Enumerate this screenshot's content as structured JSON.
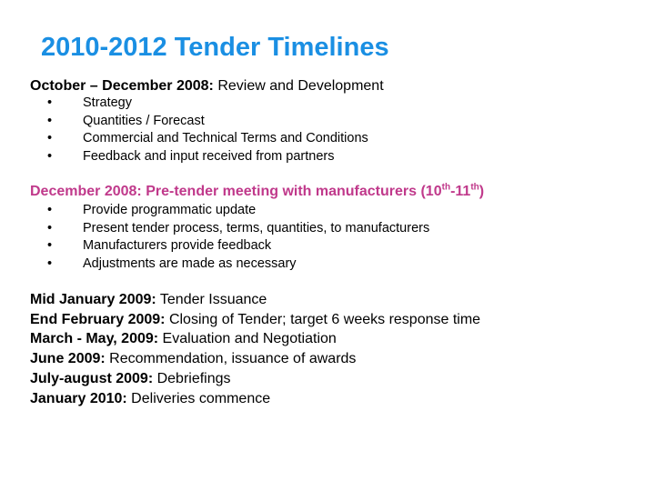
{
  "title": "2010-2012 Tender Timelines",
  "colors": {
    "title": "#1a8fe3",
    "highlight": "#c0398b"
  },
  "section1": {
    "label": "October – December 2008:",
    "text": " Review and Development",
    "items": [
      "Strategy",
      "Quantities / Forecast",
      "Commercial and Technical Terms and Conditions",
      "Feedback and input received from partners"
    ]
  },
  "section2": {
    "label": "December 2008: Pre-tender meeting with manufacturers (10",
    "sup1": "th",
    "mid": "-11",
    "sup2": "th",
    "end": ")",
    "items": [
      "Provide programmatic update",
      "Present tender process, terms, quantities, to manufacturers",
      "Manufacturers provide feedback",
      "Adjustments are made as necessary"
    ]
  },
  "milestones": [
    {
      "label": "Mid January 2009:",
      "text": " Tender Issuance"
    },
    {
      "label": "End February 2009:",
      "text": " Closing of Tender; target 6 weeks response time"
    },
    {
      "label": "March - May, 2009:",
      "text": " Evaluation and Negotiation"
    },
    {
      "label": "June 2009:",
      "text": " Recommendation, issuance of awards"
    },
    {
      "label": "July-august 2009:",
      "text": " Debriefings"
    },
    {
      "label": "January 2010:",
      "text": " Deliveries commence"
    }
  ],
  "bullet_glyph": "•"
}
